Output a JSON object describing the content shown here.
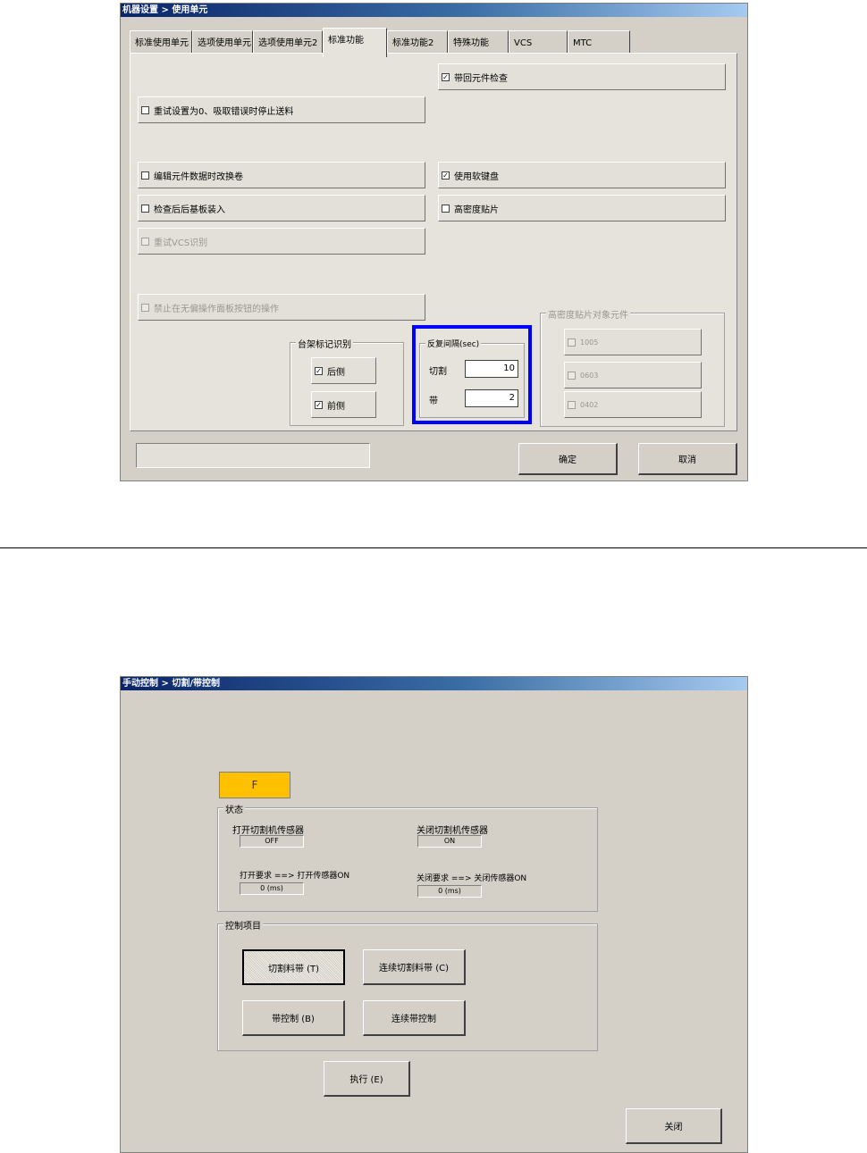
{
  "top_window": {
    "title": "机器设置 > 使用单元",
    "tabs": [
      "标准使用单元",
      "选项使用单元",
      "选项使用单元2",
      "标准功能",
      "标准功能2",
      "特殊功能",
      "VCS",
      "MTC"
    ],
    "active_tab": "标准功能",
    "options": {
      "tape_recovery_check": {
        "label": "带回元件检查",
        "checked": "✓"
      },
      "retry_zero_stop": {
        "label": "重试设置为0、吸取错误时停止送料",
        "checked": ""
      },
      "edit_part_change_reel": {
        "label": "编辑元件数据时改换卷",
        "checked": ""
      },
      "use_soft_keyboard": {
        "label": "使用软键盘",
        "checked": "✓"
      },
      "load_after_check": {
        "label": "检查后后基板装入",
        "checked": ""
      },
      "high_density_mount": {
        "label": "高密度贴片",
        "checked": ""
      },
      "retry_vcs": {
        "label": "重试VCS识别",
        "checked": ""
      },
      "disable_operation": {
        "label": "禁止在无偏操作面板按钮的操作",
        "checked": ""
      }
    },
    "frame_mark": {
      "title": "台架标记识别",
      "rear": {
        "label": "后侧",
        "checked": "✓"
      },
      "front": {
        "label": "前侧",
        "checked": "✓"
      }
    },
    "repeat_interval": {
      "title": "反复间隔(sec)",
      "cut_label": "切割",
      "cut_value": "10",
      "tape_label": "带",
      "tape_value": "2",
      "highlight_color": "#0000ff"
    },
    "hd_parts": {
      "title": "高密度贴片对象元件",
      "items": [
        {
          "label": "1005",
          "checked": ""
        },
        {
          "label": "0603",
          "checked": ""
        },
        {
          "label": "0402",
          "checked": ""
        }
      ]
    },
    "ok_label": "确定",
    "cancel_label": "取消"
  },
  "bottom_window": {
    "title": "手动控制 > 切割/带控制",
    "indicator": {
      "text": "F",
      "color": "#ffc000"
    },
    "status": {
      "title": "状态",
      "open_sensor_label": "打开切割机传感器",
      "open_sensor_value": "OFF",
      "close_sensor_label": "关闭切割机传感器",
      "close_sensor_value": "ON",
      "open_request_label": "打开要求 ==> 打开传感器ON",
      "open_request_value": "0 (ms)",
      "close_request_label": "关闭要求 ==> 关闭传感器ON",
      "close_request_value": "0 (ms)"
    },
    "control": {
      "title": "控制项目",
      "cut_tape_label": "切割料带 (T)",
      "continuous_cut_label": "连续切割料带 (C)",
      "tape_control_label": "带控制 (B)",
      "continuous_tape_label": "连续带控制"
    },
    "execute_label": "执行 (E)",
    "close_label": "关闭"
  }
}
